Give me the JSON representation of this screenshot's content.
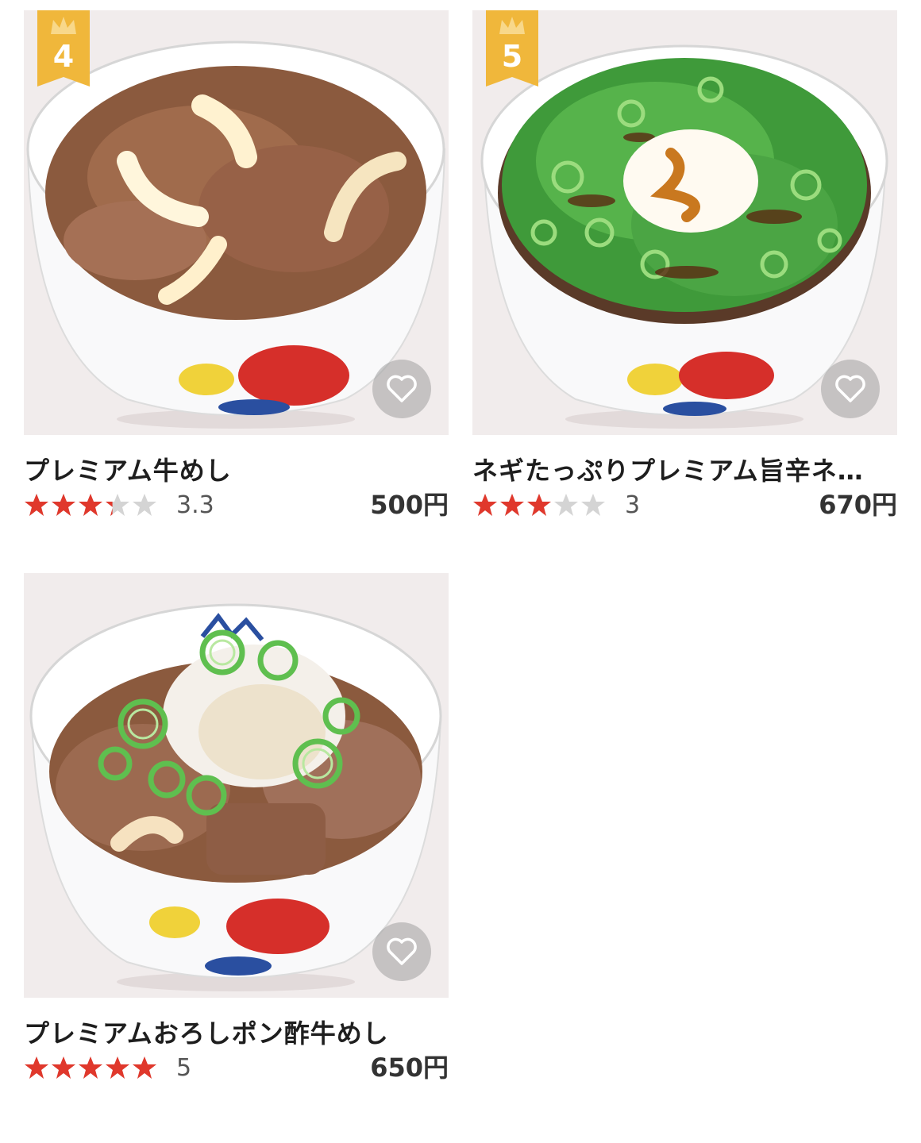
{
  "items": [
    {
      "rank": "4",
      "name": "プレミアム牛めし",
      "rating": "3.3",
      "stars": 3.3,
      "price": "500円",
      "topping": "onion"
    },
    {
      "rank": "5",
      "name": "ネギたっぷりプレミアム旨辛ネ…",
      "rating": "3",
      "stars": 3,
      "price": "670円",
      "topping": "negi-egg"
    },
    {
      "rank": "",
      "name": "プレミアムおろしポン酢牛めし",
      "rating": "5",
      "stars": 5,
      "price": "650円",
      "topping": "oroshi"
    }
  ],
  "colors": {
    "star_on": "#e0382c",
    "star_off": "#d4d4d4",
    "rank_badge": "#f0b73b",
    "favorite_bg": "#a0a0a0"
  },
  "icons": {
    "rank": "crown-icon",
    "favorite": "heart-outline-icon",
    "rating": "star-icon"
  }
}
